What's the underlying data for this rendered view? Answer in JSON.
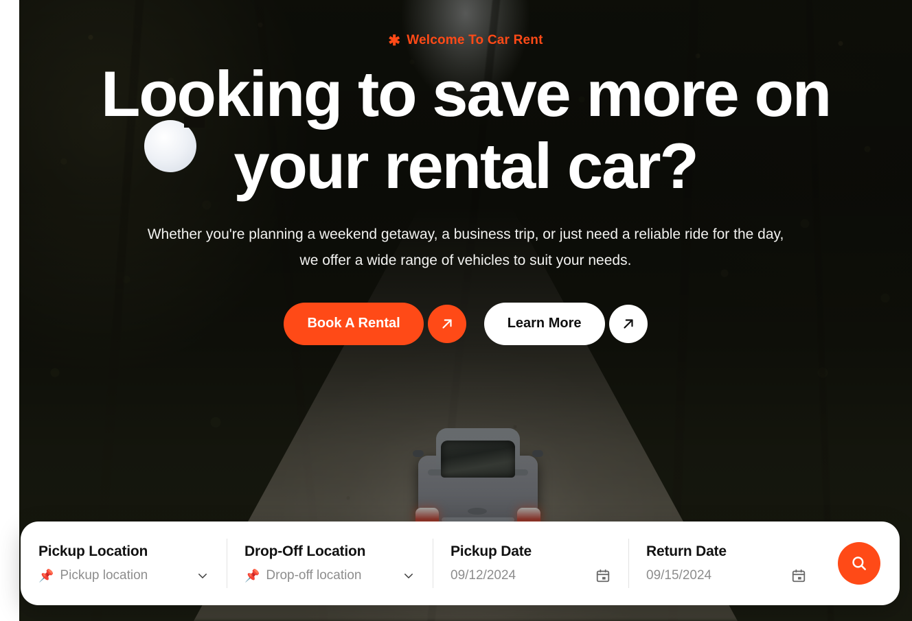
{
  "theme": {
    "accent": "#FF4A17",
    "card_background": "#FFFFFF",
    "text_dark": "#111111",
    "text_muted": "#8D8D8D"
  },
  "hero": {
    "eyebrow": {
      "icon": "sparkle-asterisk-icon",
      "text": "Welcome To Car Rent"
    },
    "headline": "Looking to save more on your rental car?",
    "subheadline": "Whether you're planning a weekend getaway, a business trip, or just need a reliable ride for the day, we offer a wide range of vehicles to suit your needs.",
    "background_image_alt": "Silver sedan parked on a gravel forest road lined with trees",
    "buttons": [
      {
        "label": "Book A Rental",
        "style": "primary",
        "icon": "arrow-up-right-icon"
      },
      {
        "label": "Learn More",
        "style": "secondary",
        "icon": "arrow-up-right-icon"
      }
    ]
  },
  "search_bar": {
    "fields": [
      {
        "label": "Pickup Location",
        "value": "Pickup location",
        "leading_icon": "map-pin-icon",
        "trailing_icon": "chevron-down-icon",
        "type": "select"
      },
      {
        "label": "Drop-Off Location",
        "value": "Drop-off location",
        "leading_icon": "map-pin-icon",
        "trailing_icon": "chevron-down-icon",
        "type": "select"
      },
      {
        "label": "Pickup Date",
        "value": "09/12/2024",
        "leading_icon": null,
        "trailing_icon": "calendar-icon",
        "type": "date"
      },
      {
        "label": "Return Date",
        "value": "09/15/2024",
        "leading_icon": null,
        "trailing_icon": "calendar-icon",
        "type": "date"
      }
    ],
    "submit": {
      "icon": "search-icon",
      "label": "Search"
    }
  }
}
